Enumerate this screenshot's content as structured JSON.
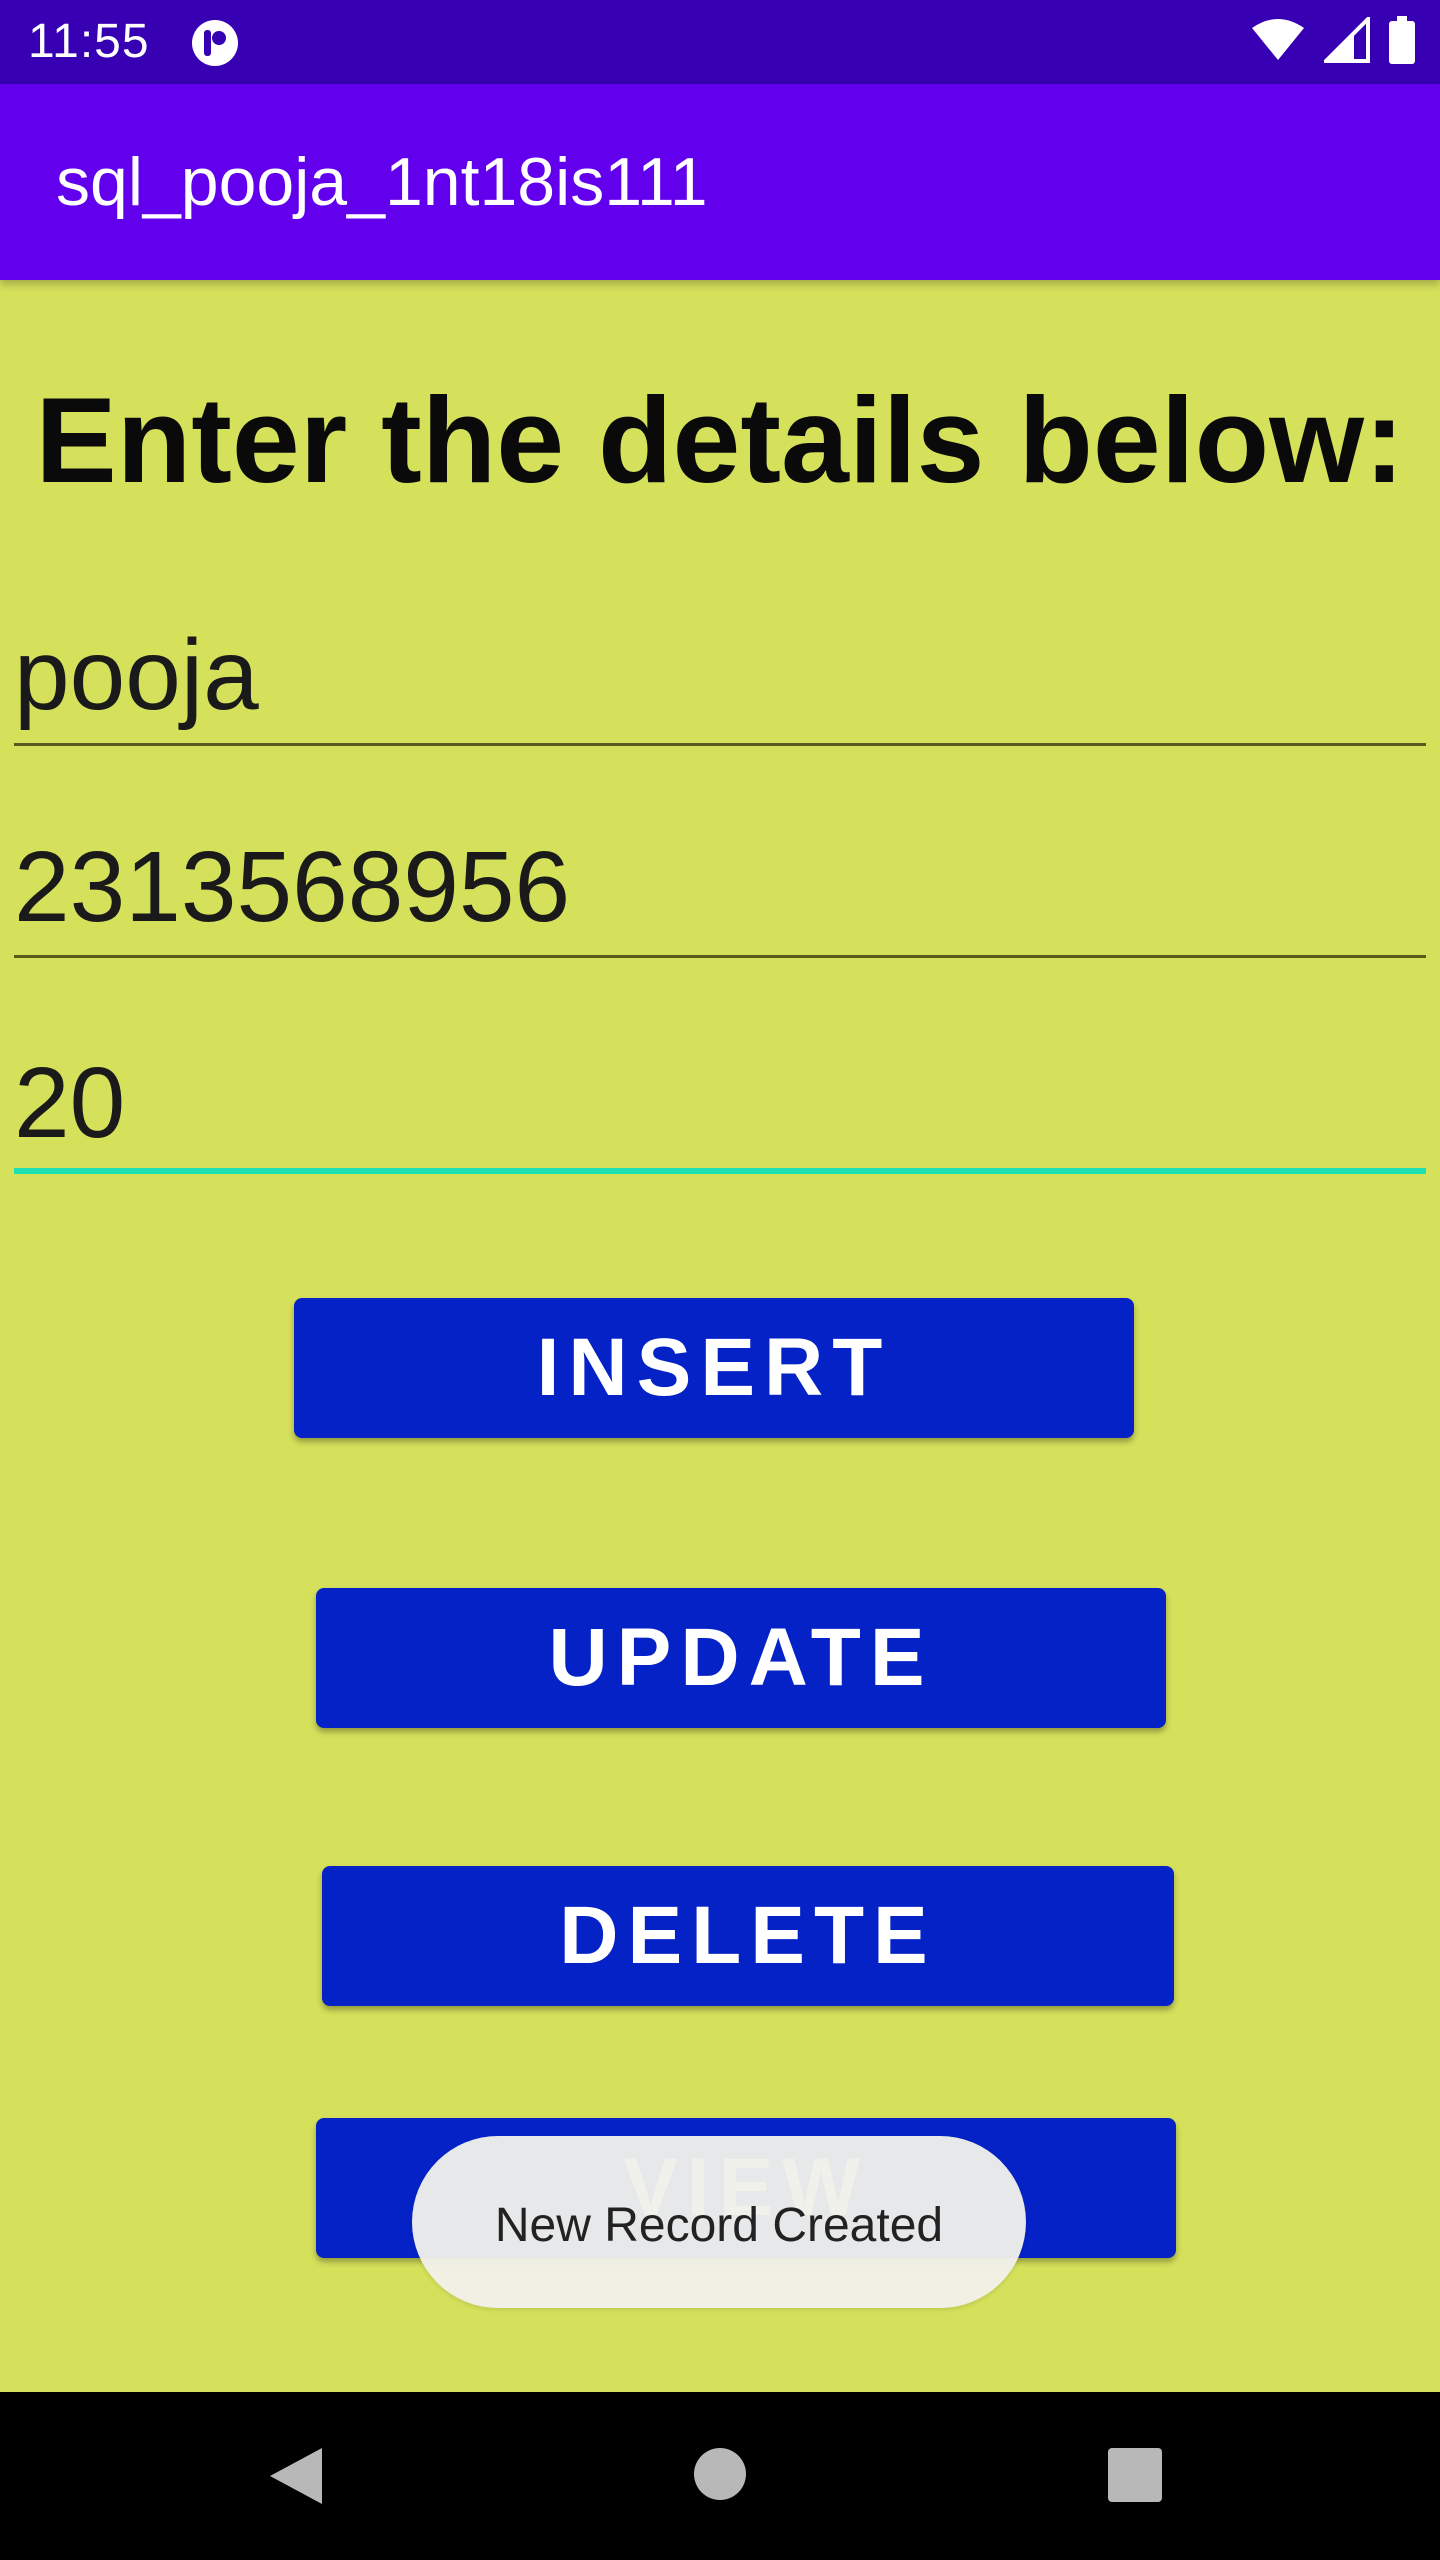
{
  "status_bar": {
    "time": "11:55",
    "app_icon": "notification-app-icon",
    "icons": [
      "wifi-icon",
      "cellular-signal-icon",
      "battery-icon"
    ]
  },
  "app_bar": {
    "title": "sql_pooja_1nt18is111"
  },
  "form": {
    "heading": "Enter the details below:",
    "fields": [
      {
        "value": "pooja",
        "focused": false
      },
      {
        "value": "2313568956",
        "focused": false
      },
      {
        "value": "20",
        "focused": true
      }
    ]
  },
  "buttons": {
    "insert": "INSERT",
    "update": "UPDATE",
    "delete": "DELETE",
    "view": "VIEW"
  },
  "toast": {
    "message": "New Record Created"
  },
  "nav_bar": {
    "icons": [
      "back-icon",
      "home-icon",
      "recents-icon"
    ]
  },
  "colors": {
    "status_bar": "#3700b3",
    "app_bar": "#6200ee",
    "background": "#d5e05b",
    "button": "#0522c7",
    "focus_accent": "#1ee0b0"
  }
}
